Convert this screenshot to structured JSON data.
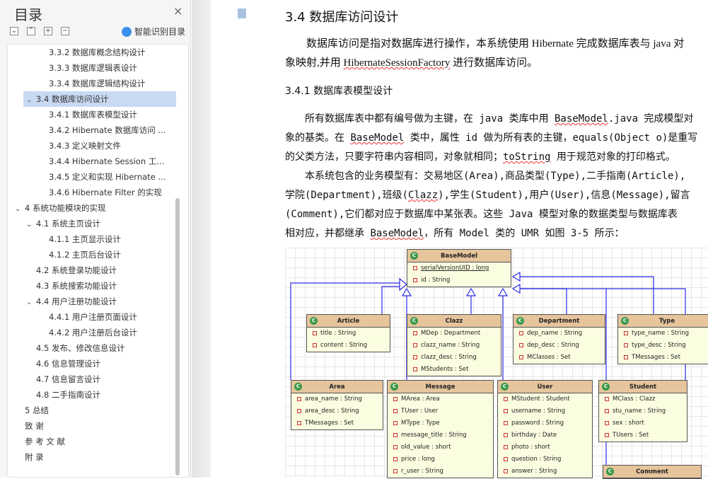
{
  "sidebar": {
    "title": "目录",
    "close": "×",
    "smart_label": "智能识别目录",
    "toolbar": [
      "⌄",
      "⌃",
      "+",
      "−"
    ],
    "items": [
      {
        "label": "3.3.2  数据库概念结构设计",
        "level": 3
      },
      {
        "label": "3.3.3  数据库逻辑表设计",
        "level": 3
      },
      {
        "label": "3.3.4  数据库逻辑结构设计",
        "level": 3
      },
      {
        "label": "3.4  数据库访问设计",
        "level": 2,
        "expanded": true,
        "selected": true
      },
      {
        "label": "3.4.1  数据库表模型设计",
        "level": 3
      },
      {
        "label": "3.4.2 Hibernate 数据库访问 ...",
        "level": 3
      },
      {
        "label": "3.4.3  定义映射文件",
        "level": 3
      },
      {
        "label": "3.4.4 Hibernate Session 工...",
        "level": 3
      },
      {
        "label": "3.4.5  定义和实现 Hibernate ...",
        "level": 3
      },
      {
        "label": "3.4.6 Hibernate Filter 的实现",
        "level": 3
      },
      {
        "label": "4  系统功能模块的实现",
        "level": 1,
        "expanded": true
      },
      {
        "label": "4.1  系统主页设计",
        "level": 2,
        "expanded": true
      },
      {
        "label": "4.1.1  主页显示设计",
        "level": 3
      },
      {
        "label": "4.1.2  主页后台设计",
        "level": 3
      },
      {
        "label": "4.2  系统登录功能设计",
        "level": 2
      },
      {
        "label": "4.3  系统搜索功能设计",
        "level": 2
      },
      {
        "label": "4.4  用户注册功能设计",
        "level": 2,
        "expanded": true
      },
      {
        "label": "4.4.1  用户注册页面设计",
        "level": 3
      },
      {
        "label": "4.4.2  用户注册后台设计",
        "level": 3
      },
      {
        "label": "4.5  发布、修改信息设计",
        "level": 2
      },
      {
        "label": "4.6 信息管理设计",
        "level": 2
      },
      {
        "label": "4.7  信息留言设计",
        "level": 2
      },
      {
        "label": "4.8  二手指南设计",
        "level": 2
      },
      {
        "label": "5 总结",
        "level": 1
      },
      {
        "label": "致  谢",
        "level": 1
      },
      {
        "label": "参  考  文  献",
        "level": 1
      },
      {
        "label": "附  录",
        "level": 1
      }
    ]
  },
  "document": {
    "heading": "3.4  数据库访问设计",
    "para1": [
      "数据库访问是指对数据库进行操作，本系统使用 Hibernate 完成数据库表与 java 对",
      "象映射,并用 ",
      "HibernateSessionFactory",
      " 进行数据库访问。"
    ],
    "subheading": "3.4.1  数据库表模型设计",
    "para2": [
      "所有数据库表中都有编号做为主键，在 java 类库中用 ",
      "BaseModel",
      ".java 完成模型对",
      "象的基类。在 ",
      "BaseModel",
      " 类中，属性 id 做为所有表的主键，equals(Object o)是重写",
      "的父类方法，只要字符串内容相同，对象就相同；",
      "toString",
      " 用于规范对象的打印格式。"
    ],
    "para3": [
      "本系统包含的业务模型有：交易地区(Area),商品类型(Type),二手指南(Article),",
      "学院(Department),班级(",
      "Clazz",
      "),学生(Student),用户(User),信息(Message),留言",
      "(Comment),它们都对应于数据库中某张表。这些 Java 模型对象的数据类型与数据库表",
      "相对应，并都继承 ",
      "BaseModel",
      "，所有 Model 类的 UMR 如图 3-5 所示："
    ]
  },
  "uml": {
    "classes": [
      {
        "name": "BaseModel",
        "attrs": [
          "serialVersionUID : long",
          "id : String"
        ]
      },
      {
        "name": "Article",
        "attrs": [
          "title : String",
          "content : String"
        ]
      },
      {
        "name": "Clazz",
        "attrs": [
          "MDep : Department",
          "clazz_name : String",
          "clazz_desc : String",
          "MStudents : Set"
        ]
      },
      {
        "name": "Department",
        "attrs": [
          "dep_name : String",
          "dep_desc : String",
          "MClasses : Set"
        ]
      },
      {
        "name": "Type",
        "attrs": [
          "type_name : String",
          "type_desc : String",
          "TMessages : Set"
        ]
      },
      {
        "name": "Area",
        "attrs": [
          "area_name : String",
          "area_desc : String",
          "TMessages : Set"
        ]
      },
      {
        "name": "Message",
        "attrs": [
          "MArea : Area",
          "TUser : User",
          "MType : Type",
          "message_title : String",
          "old_value : short",
          "price : long",
          "r_user : String"
        ]
      },
      {
        "name": "User",
        "attrs": [
          "MStudent : Student",
          "username : String",
          "password : String",
          "birthday : Date",
          "photo : short",
          "question : String",
          "answer : String"
        ]
      },
      {
        "name": "Student",
        "attrs": [
          "MClass : Clazz",
          "stu_name : String",
          "sex : short",
          "TUsers : Set"
        ]
      },
      {
        "name": "Comment",
        "attrs": []
      }
    ],
    "line_color": "#2a2ae8"
  }
}
